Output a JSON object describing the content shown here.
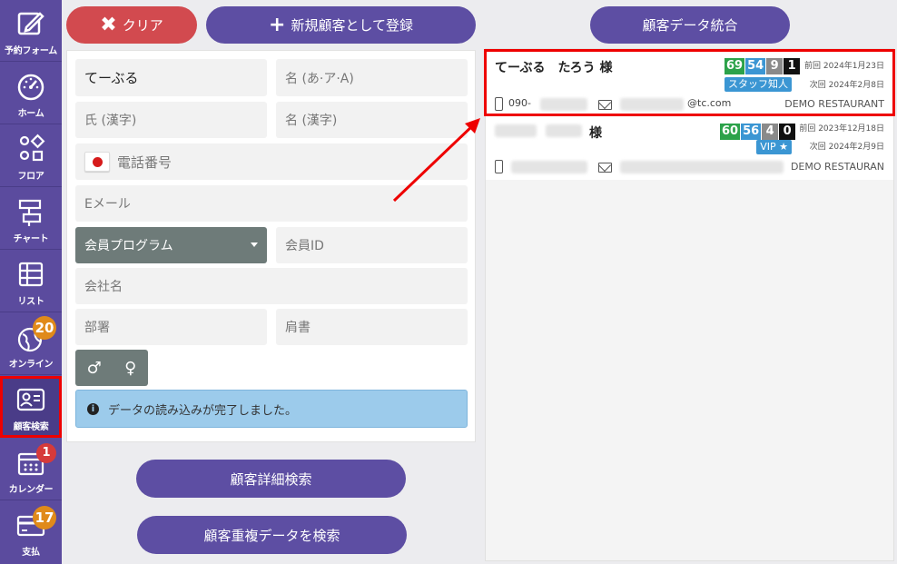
{
  "sidebar": {
    "items": [
      {
        "label": "予約フォーム",
        "icon": "edit-icon"
      },
      {
        "label": "ホーム",
        "icon": "dashboard-icon"
      },
      {
        "label": "フロア",
        "icon": "floor-icon"
      },
      {
        "label": "チャート",
        "icon": "chart-icon"
      },
      {
        "label": "リスト",
        "icon": "list-icon"
      },
      {
        "label": "オンライン",
        "icon": "globe-icon",
        "badge": "20"
      },
      {
        "label": "顧客検索",
        "icon": "customer-card-icon"
      },
      {
        "label": "カレンダー",
        "icon": "calendar-icon",
        "badge": "1"
      },
      {
        "label": "支払",
        "icon": "credit-card-icon",
        "badge": "17"
      }
    ]
  },
  "toolbar": {
    "clear_label": "クリア",
    "register_label": "新規顧客として登録",
    "merge_label": "顧客データ統合"
  },
  "form": {
    "last_name_kana": "てーぶる",
    "first_name_kana_placeholder": "名 (あ·ア·A)",
    "last_name_kanji_placeholder": "氏 (漢字)",
    "first_name_kanji_placeholder": "名 (漢字)",
    "phone_placeholder": "電話番号",
    "email_placeholder": "Eメール",
    "member_program": "会員プログラム",
    "member_id_placeholder": "会員ID",
    "company_placeholder": "会社名",
    "department_placeholder": "部署",
    "title_placeholder": "肩書",
    "male_symbol": "♂",
    "female_symbol": "♀",
    "status_message": "データの読み込みが完了しました。"
  },
  "buttons": {
    "detail_search": "顧客詳細検索",
    "duplicate_search": "顧客重複データを検索"
  },
  "results": [
    {
      "name": "てーぶる　たろう 様",
      "scores": [
        "69",
        "54",
        "9",
        "1"
      ],
      "last_visit": "前回 2024年1月23日",
      "next_visit": "次回 2024年2月8日",
      "tag": "スタッフ知人",
      "phone": "090-",
      "email": "@tc.com",
      "restaurant": "DEMO RESTAURANT"
    },
    {
      "name": "様",
      "scores": [
        "60",
        "56",
        "4",
        "0"
      ],
      "last_visit": "前回 2023年12月18日",
      "next_visit": "次回 2024年2月9日",
      "tag": "VIP ★",
      "restaurant": "DEMO RESTAURAN"
    }
  ],
  "colors": {
    "sidebar": "#5b4b9e",
    "score1": "#2ca24a",
    "score2": "#3b96d3",
    "score3": "#8a8a8a",
    "score4": "#111111",
    "highlight": "#ee0000"
  }
}
